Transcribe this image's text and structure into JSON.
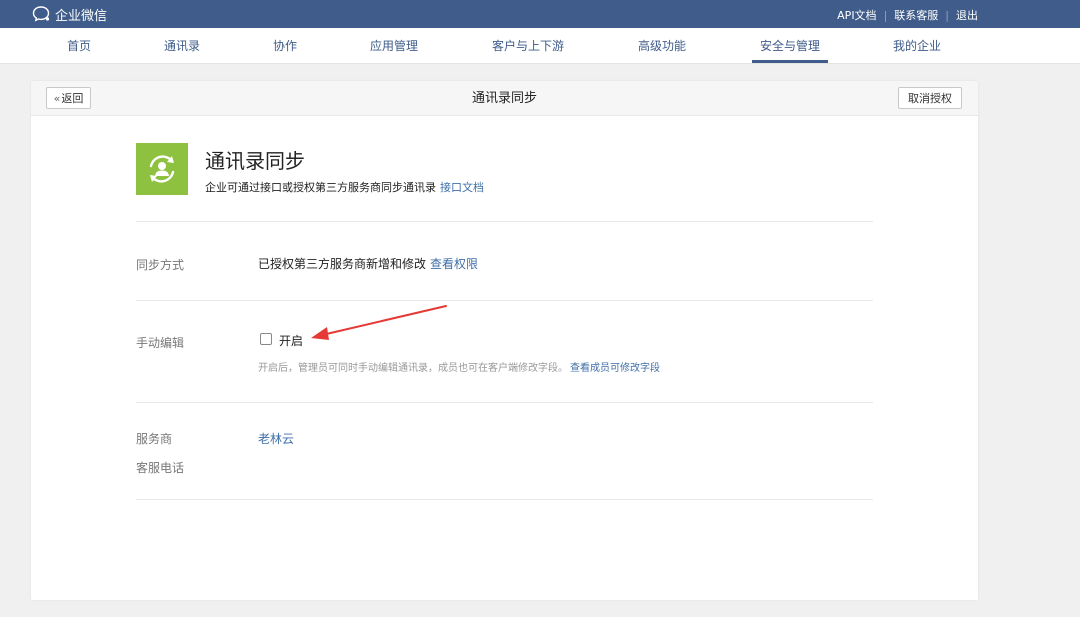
{
  "topbar": {
    "logo_text": "企业微信",
    "links": [
      "API文档",
      "联系客服",
      "退出"
    ]
  },
  "nav": {
    "items": [
      "首页",
      "通讯录",
      "协作",
      "应用管理",
      "客户与上下游",
      "高级功能",
      "安全与管理",
      "我的企业"
    ],
    "active": "安全与管理"
  },
  "page": {
    "back_label": "返回",
    "title": "通讯录同步",
    "revoke_label": "取消授权"
  },
  "app": {
    "icon": "contacts-sync-icon",
    "title": "通讯录同步",
    "description": "企业可通过接口或授权第三方服务商同步通讯录",
    "doc_link": "接口文档"
  },
  "sync_method": {
    "label": "同步方式",
    "value": "已授权第三方服务商新增和修改",
    "link": "查看权限"
  },
  "manual_edit": {
    "label": "手动编辑",
    "checkbox_label": "开启",
    "checked": false,
    "hint": "开启后，管理员可同时手动编辑通讯录，成员也可在客户端修改字段。",
    "hint_link": "查看成员可修改字段"
  },
  "provider": {
    "label": "服务商",
    "value": "老林云",
    "phone_label": "客服电话"
  },
  "colors": {
    "brand": "#3f5c8a",
    "link": "#3f6fa8",
    "app_icon_bg": "#8dc13f",
    "annotation_arrow": "#e53935"
  }
}
